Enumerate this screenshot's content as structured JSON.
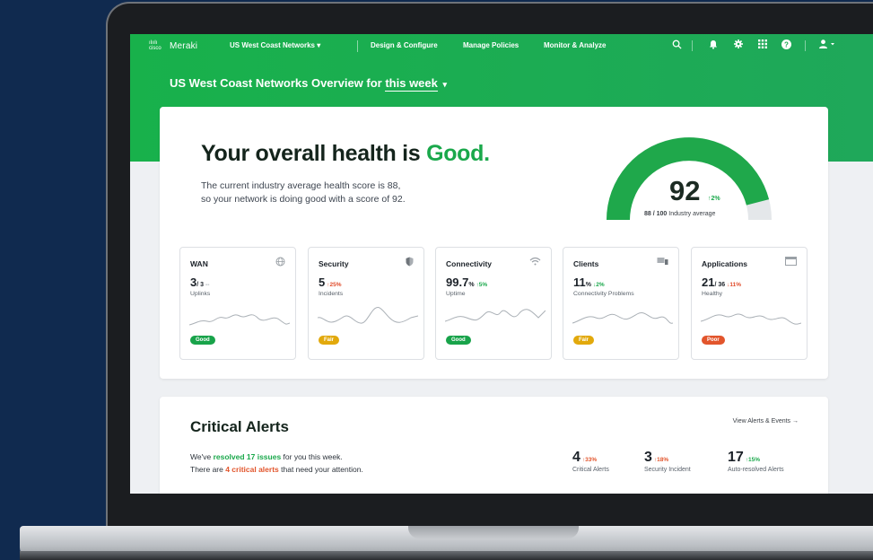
{
  "nav": {
    "logo_cisco": "ılıılı cisco",
    "logo_meraki": "Meraki",
    "org_selector": "US West Coast Networks ▾",
    "links": [
      "Design & Configure",
      "Manage Policies",
      "Monitor & Analyze"
    ],
    "icons": [
      "search-icon",
      "bell-icon",
      "gear-icon",
      "grid-icon",
      "help-icon",
      "user-icon"
    ]
  },
  "overview": {
    "prefix": "US West Coast Networks Overview for ",
    "period": "this week",
    "caret": "▾"
  },
  "health": {
    "headline_prefix": "Your overall health is ",
    "headline_status": "Good.",
    "sub_line1": "The current industry average health score is 88,",
    "sub_line2": "so your network is doing good with a score of 92.",
    "score": "92",
    "score_delta": "↑2%",
    "industry_value": "88 / 100",
    "industry_label": "Industry average",
    "gauge_fraction": 0.92,
    "industry_fraction": 0.88
  },
  "metrics": [
    {
      "title": "WAN",
      "icon": "globe-icon",
      "value": "3",
      "value_small": "/ 3",
      "delta": "--",
      "label": "Uplinks",
      "badge": "Good",
      "badge_kind": "good"
    },
    {
      "title": "Security",
      "icon": "shield-icon",
      "value": "5",
      "value_small": "",
      "delta": "↑25%",
      "label": "Incidents",
      "badge": "Fair",
      "badge_kind": "fair"
    },
    {
      "title": "Connectivity",
      "icon": "wifi-icon",
      "value": "99.7",
      "value_small": "%",
      "delta": "↑5%",
      "label": "Uptime",
      "badge": "Good",
      "badge_kind": "good"
    },
    {
      "title": "Clients",
      "icon": "devices-icon",
      "value": "11",
      "value_small": "%",
      "delta": "↓2%",
      "label": "Connectivity Problems",
      "badge": "Fair",
      "badge_kind": "fair"
    },
    {
      "title": "Applications",
      "icon": "window-icon",
      "value": "21",
      "value_small": "/ 36",
      "delta": "↓11%",
      "label": "Healthy",
      "badge": "Poor",
      "badge_kind": "poor"
    }
  ],
  "alerts": {
    "title": "Critical Alerts",
    "view_link": "View Alerts & Events →",
    "line1_prefix": "We've ",
    "line1_highlight": "resolved 17 issues",
    "line1_suffix": " for you this week.",
    "line2_prefix": "There are ",
    "line2_highlight": "4 critical alerts",
    "line2_suffix": " that need your attention.",
    "stats": [
      {
        "value": "4",
        "delta": "↑33%",
        "label": "Critical Alerts"
      },
      {
        "value": "3",
        "delta": "↑18%",
        "label": "Security Incident"
      },
      {
        "value": "17",
        "delta": "↑15%",
        "label": "Auto-resolved Alerts"
      }
    ]
  },
  "colors": {
    "brand_green": "#18b14b",
    "good": "#18a34a",
    "fair": "#e2a90c",
    "poor": "#e2552c"
  }
}
